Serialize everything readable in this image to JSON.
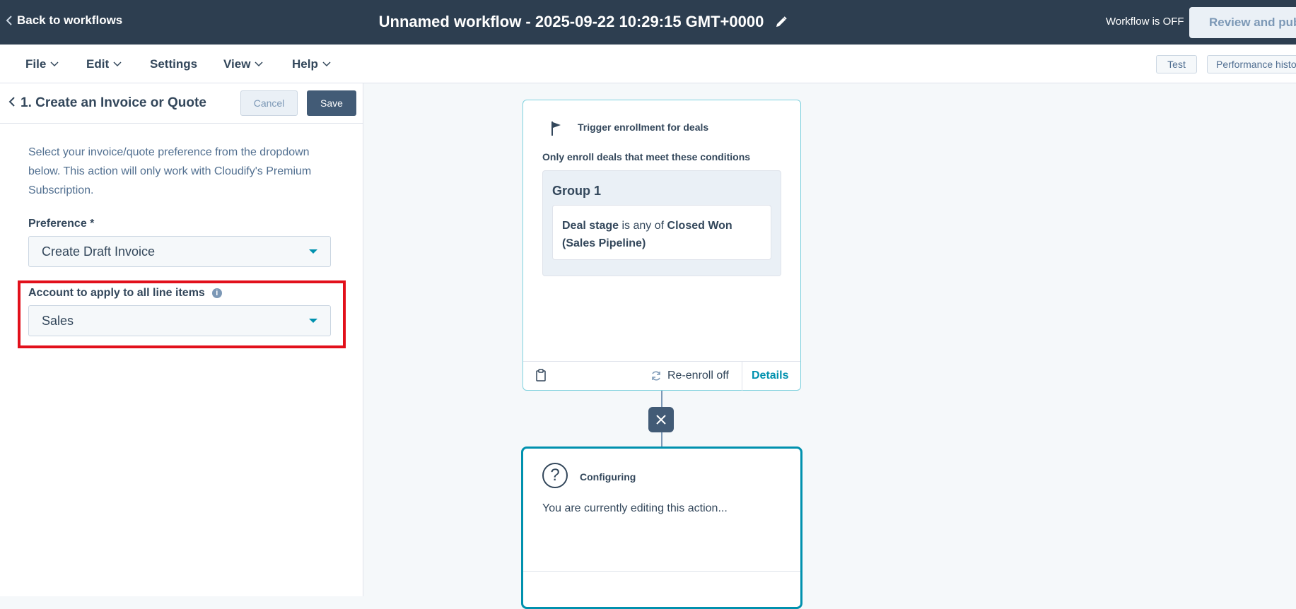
{
  "topbar": {
    "back_label": "Back to workflows",
    "title": "Unnamed workflow - 2025-09-22 10:29:15 GMT+0000",
    "status": "Workflow is OFF",
    "review_label": "Review and publish"
  },
  "menubar": {
    "items": [
      {
        "label": "File",
        "dropdown": true
      },
      {
        "label": "Edit",
        "dropdown": true
      },
      {
        "label": "Settings",
        "dropdown": false
      },
      {
        "label": "View",
        "dropdown": true
      },
      {
        "label": "Help",
        "dropdown": true
      }
    ],
    "test_label": "Test",
    "performance_label": "Performance history"
  },
  "panel": {
    "title": "1. Create an Invoice or Quote",
    "cancel_label": "Cancel",
    "save_label": "Save",
    "description": "Select your invoice/quote preference from the dropdown below. This action will only work with Cloudify's Premium Subscription.",
    "preference": {
      "label": "Preference *",
      "value": "Create Draft Invoice"
    },
    "account": {
      "label": "Account to apply to all line items",
      "value": "Sales"
    }
  },
  "trigger": {
    "title": "Trigger enrollment for deals",
    "subtitle": "Only enroll deals that meet these conditions",
    "group_title": "Group 1",
    "condition": {
      "property": "Deal stage",
      "operator": "is any of",
      "value": "Closed Won (Sales Pipeline)"
    },
    "reenroll_label": "Re-enroll off",
    "details_label": "Details"
  },
  "configuring": {
    "title": "Configuring",
    "text": "You are currently editing this action..."
  },
  "colors": {
    "topbar": "#2d3e50",
    "accent": "#0091ae",
    "highlight": "#e2101b",
    "save_button": "#425b76"
  }
}
